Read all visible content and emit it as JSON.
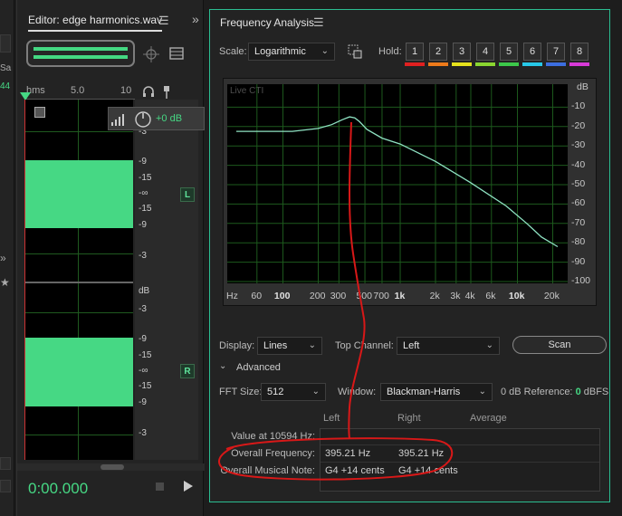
{
  "left_strip": {
    "frag1": "Sa",
    "frag2": "44"
  },
  "editor": {
    "tab_title": "Editor: edge harmonics.wav",
    "menu_icon": "hamburger-icon",
    "ruler": {
      "unit": "hms",
      "mark1": "5.0",
      "mark2": "10"
    },
    "volume_label": "+0 dB",
    "channels": {
      "left": "L",
      "right": "R"
    },
    "db_scale_top": [
      "-3",
      "-9",
      "-15",
      "-∞",
      "-15",
      "-9",
      "-3"
    ],
    "db_unit": "dB",
    "db_scale_bottom": [
      "-3",
      "-9",
      "-15",
      "-∞",
      "-15",
      "-9",
      "-3"
    ],
    "time": "0:00.000",
    "colors": {
      "wave": "#46d884",
      "time": "#46d884"
    }
  },
  "freq_analysis": {
    "title": "Frequency Analysis",
    "scale_label": "Scale:",
    "scale_value": "Logarithmic",
    "hold_label": "Hold:",
    "hold_buttons": [
      "1",
      "2",
      "3",
      "4",
      "5",
      "6",
      "7",
      "8"
    ],
    "hold_colors": [
      "#e02020",
      "#ee7a1a",
      "#e6e21c",
      "#8ad630",
      "#3cc84a",
      "#27c8e8",
      "#3c6ee0",
      "#d83ad8"
    ],
    "live_label": "Live CTI",
    "y_unit": "dB",
    "y_ticks": [
      "-10",
      "-20",
      "-30",
      "-40",
      "-50",
      "-60",
      "-70",
      "-80",
      "-90",
      "-100"
    ],
    "x_unit": "Hz",
    "x_ticks": [
      "60",
      "100",
      "200",
      "300",
      "500",
      "700",
      "1k",
      "2k",
      "3k",
      "4k",
      "6k",
      "10k",
      "20k"
    ],
    "display_label": "Display:",
    "display_value": "Lines",
    "top_channel_label": "Top Channel:",
    "top_channel_value": "Left",
    "scan_label": "Scan",
    "advanced_label": "Advanced",
    "fft_label": "FFT Size:",
    "fft_value": "512",
    "window_label": "Window:",
    "window_value": "Blackman-Harris",
    "reference_label": "0 dB Reference:",
    "reference_value": "0",
    "reference_unit": "dBFS",
    "table": {
      "headers": [
        "Left",
        "Right",
        "Average"
      ],
      "rows": [
        {
          "label": "Value at 10594 Hz:",
          "left": "",
          "right": "",
          "average": ""
        },
        {
          "label": "Overall Frequency:",
          "left": "395.21 Hz",
          "right": "395.21 Hz",
          "average": ""
        },
        {
          "label": "Overall Musical Note:",
          "left": "G4 +14 cents",
          "right": "G4 +14 cents",
          "average": ""
        }
      ]
    },
    "colors": {
      "border": "#2bbd91",
      "curve": "#8fe3c3",
      "annotation": "#d81818",
      "ref_value": "#46d884"
    }
  }
}
